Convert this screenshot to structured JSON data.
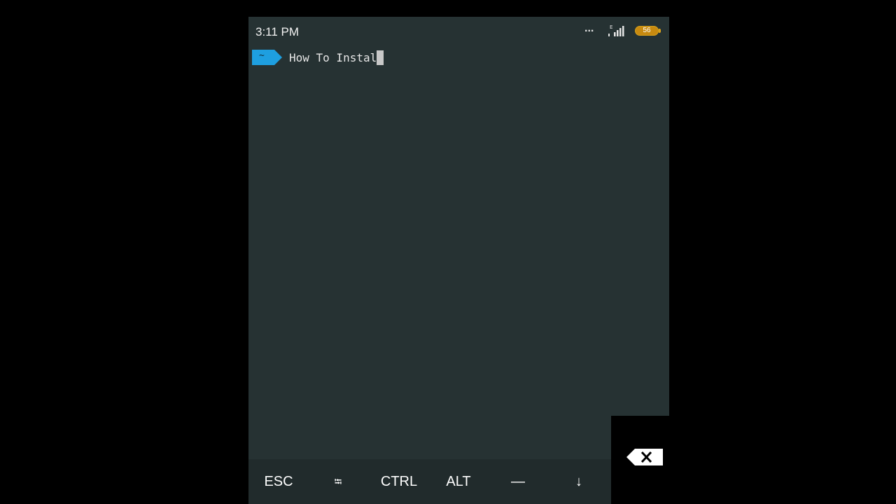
{
  "status_bar": {
    "time": "3:11 PM",
    "overflow_dots": "...",
    "network_label": "E",
    "battery_level": "56"
  },
  "terminal": {
    "prompt_symbol": "~",
    "command": "How To Instal"
  },
  "extra_keys": [
    {
      "label": "ESC",
      "name": "esc-key"
    },
    {
      "label": "⭾",
      "name": "tab-key"
    },
    {
      "label": "CTRL",
      "name": "ctrl-key"
    },
    {
      "label": "ALT",
      "name": "alt-key"
    },
    {
      "label": "—",
      "name": "dash-key"
    },
    {
      "label": "↓",
      "name": "arrow-down-key"
    }
  ],
  "colors": {
    "background": "#263233",
    "prompt_accent": "#1e9fe0",
    "battery": "#c88a10"
  }
}
